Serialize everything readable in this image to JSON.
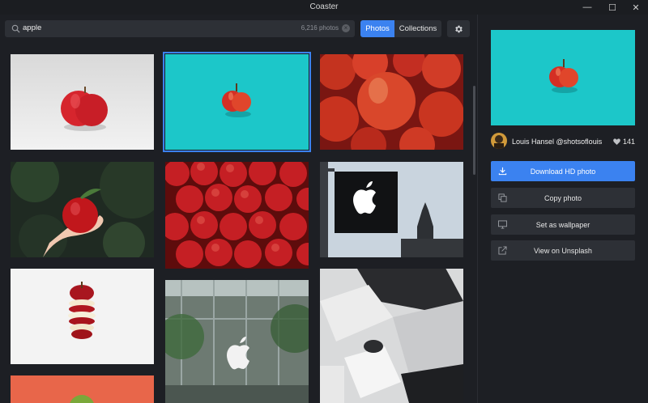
{
  "window": {
    "title": "Coaster",
    "minimize_glyph": "—",
    "maximize_glyph": "☐",
    "close_glyph": "✕"
  },
  "search": {
    "value": "apple",
    "count": "6,216 photos",
    "clear_glyph": "×"
  },
  "tabs": {
    "photos": "Photos",
    "collections": "Collections",
    "active": "photos"
  },
  "photos": [
    {
      "subject": "red apple on white"
    },
    {
      "subject": "red apple on teal",
      "selected": true
    },
    {
      "subject": "pile of red apples"
    },
    {
      "subject": "hand holding apple"
    },
    {
      "subject": "rows of red apples"
    },
    {
      "subject": "apple store logo sign"
    },
    {
      "subject": "sliced floating apple"
    },
    {
      "subject": "apple store glass facade"
    },
    {
      "subject": "apple devices flat lay"
    },
    {
      "subject": "apple on orange"
    }
  ],
  "detail": {
    "author": "Louis Hansel @shotsoflouis",
    "likes": "141",
    "actions": [
      {
        "label": "Download HD photo",
        "icon": "download-icon",
        "primary": true
      },
      {
        "label": "Copy photo",
        "icon": "copy-icon",
        "primary": false
      },
      {
        "label": "Set as wallpaper",
        "icon": "monitor-icon",
        "primary": false
      },
      {
        "label": "View on Unsplash",
        "icon": "external-link-icon",
        "primary": false
      }
    ]
  },
  "colors": {
    "accent": "#3b82f0",
    "background": "#1d1f24",
    "control": "#2d3036",
    "teal": "#1cc7c9"
  }
}
